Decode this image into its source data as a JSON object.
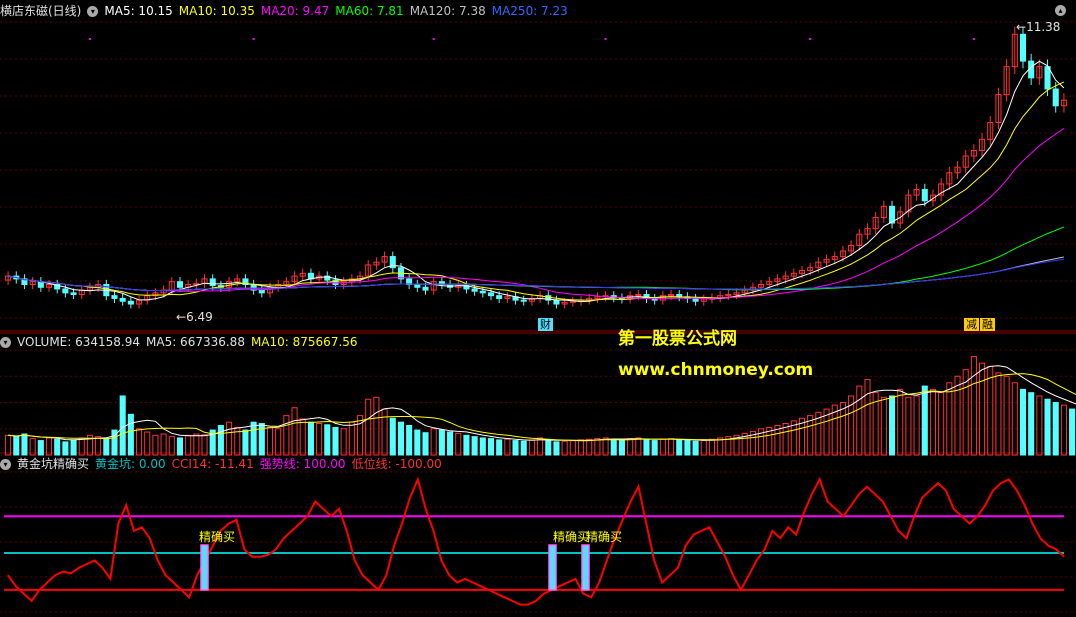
{
  "header_main": {
    "title": "横店东磁(日线)",
    "ma5": "MA5: 10.15",
    "ma10": "MA10: 10.35",
    "ma20": "MA20: 9.47",
    "ma60": "MA60: 7.81",
    "ma120": "MA120: 7.38",
    "ma250": "MA250: 7.23"
  },
  "header_volume": {
    "volume": "VOLUME: 634158.94",
    "ma5": "MA5: 667336.88",
    "ma10": "MA10: 875667.56"
  },
  "header_indicator": {
    "title": "黄金坑精确买",
    "golden_pit": "黄金坑: 0.00",
    "cci": "CCI14: -11.41",
    "strong_line": "强势线: 100.00",
    "low_line": "低位线: -100.00"
  },
  "annotations": {
    "high_label": "11.38",
    "low_label": "6.49",
    "cai_badge": "财",
    "jian_badge": "减",
    "rong_badge": "融",
    "buy_signal_1": "精确买",
    "buy_signal_2": "精确买",
    "buy_signal_3": "精确买"
  },
  "watermark": {
    "line1": "第一股票公式网",
    "line2": "www.chnmoney.com"
  },
  "colors": {
    "up": "#ff3232",
    "down": "#54ffff",
    "ma5": "#ffffff",
    "ma10": "#ffff00",
    "ma20": "#ff00ff",
    "ma60": "#00ff00",
    "ma120": "#c0c0c0",
    "ma250": "#3333ff",
    "cci": "#ff0000",
    "strong": "#ff00ff",
    "zero": "#00c0c0",
    "low": "#ff0000"
  },
  "chart_data": [
    {
      "type": "candlestick",
      "title": "横店东磁(日线)",
      "price_range": [
        6.3,
        11.6
      ],
      "high_marker": 11.38,
      "low_marker": 6.49,
      "close_series": [
        7.05,
        7.0,
        6.9,
        6.95,
        6.85,
        6.9,
        6.82,
        6.75,
        6.72,
        6.8,
        6.85,
        6.9,
        6.7,
        6.65,
        6.6,
        6.55,
        6.62,
        6.7,
        6.75,
        6.8,
        6.95,
        6.85,
        6.9,
        6.92,
        7.0,
        6.88,
        6.85,
        6.95,
        7.0,
        6.9,
        6.8,
        6.75,
        6.85,
        6.9,
        6.95,
        7.05,
        7.1,
        7.0,
        7.05,
        6.98,
        6.9,
        6.95,
        7.0,
        7.05,
        7.25,
        7.3,
        7.4,
        7.2,
        7.0,
        6.9,
        6.85,
        6.8,
        6.95,
        6.9,
        6.85,
        6.88,
        6.82,
        6.78,
        6.75,
        6.7,
        6.65,
        6.68,
        6.62,
        6.6,
        6.65,
        6.7,
        6.62,
        6.55,
        6.58,
        6.6,
        6.62,
        6.65,
        6.68,
        6.7,
        6.66,
        6.64,
        6.7,
        6.72,
        6.65,
        6.62,
        6.7,
        6.72,
        6.68,
        6.65,
        6.6,
        6.64,
        6.66,
        6.7,
        6.72,
        6.75,
        6.8,
        6.85,
        6.9,
        6.95,
        7.0,
        7.05,
        7.1,
        7.15,
        7.2,
        7.3,
        7.35,
        7.4,
        7.5,
        7.6,
        7.8,
        7.9,
        8.1,
        8.3,
        8.0,
        8.2,
        8.5,
        8.6,
        8.4,
        8.5,
        8.7,
        8.9,
        9.0,
        9.2,
        9.3,
        9.5,
        9.8,
        10.3,
        10.8,
        11.38,
        10.9,
        10.6,
        10.8,
        10.4,
        10.1,
        10.2
      ],
      "ma_series": [
        {
          "name": "MA5",
          "last": 10.15
        },
        {
          "name": "MA10",
          "last": 10.35
        },
        {
          "name": "MA20",
          "last": 9.47
        },
        {
          "name": "MA60",
          "last": 7.81
        },
        {
          "name": "MA120",
          "last": 7.38
        },
        {
          "name": "MA250",
          "last": 7.23
        }
      ]
    },
    {
      "type": "bar",
      "title": "VOLUME",
      "volume_max": 1600000,
      "volume_series": [
        300000,
        280000,
        320000,
        250000,
        220000,
        260000,
        240000,
        200000,
        230000,
        260000,
        300000,
        280000,
        250000,
        380000,
        900000,
        620000,
        400000,
        350000,
        300000,
        320000,
        280000,
        260000,
        300000,
        320000,
        310000,
        380000,
        450000,
        500000,
        420000,
        380000,
        500000,
        480000,
        420000,
        400000,
        600000,
        720000,
        550000,
        500000,
        480000,
        460000,
        420000,
        400000,
        500000,
        600000,
        850000,
        880000,
        700000,
        560000,
        500000,
        450000,
        380000,
        340000,
        400000,
        380000,
        350000,
        330000,
        300000,
        280000,
        260000,
        250000,
        230000,
        240000,
        220000,
        210000,
        230000,
        260000,
        220000,
        200000,
        210000,
        220000,
        230000,
        240000,
        250000,
        260000,
        240000,
        230000,
        250000,
        260000,
        240000,
        220000,
        240000,
        250000,
        230000,
        220000,
        210000,
        220000,
        240000,
        260000,
        280000,
        300000,
        330000,
        360000,
        400000,
        420000,
        450000,
        480000,
        520000,
        560000,
        600000,
        650000,
        700000,
        760000,
        800000,
        900000,
        1050000,
        1150000,
        950000,
        880000,
        900000,
        1000000,
        880000,
        900000,
        1050000,
        1000000,
        950000,
        1100000,
        1200000,
        1300000,
        1500000,
        1400000,
        1350000,
        1250000,
        1200000,
        1100000,
        1000000,
        950000,
        900000,
        850000,
        800000,
        760000,
        700000,
        650000
      ],
      "ma_series": [
        {
          "name": "MA5",
          "last": 667336.88
        },
        {
          "name": "MA10",
          "last": 875667.56
        }
      ]
    },
    {
      "type": "line",
      "title": "黄金坑精确买",
      "value_range": [
        -160,
        220
      ],
      "levels": {
        "strong": 100,
        "zero": 0,
        "low": -100
      },
      "cci_series": [
        -60,
        -90,
        -110,
        -130,
        -100,
        -80,
        -60,
        -50,
        -55,
        -40,
        -30,
        -20,
        -40,
        -70,
        80,
        130,
        60,
        70,
        40,
        -20,
        -60,
        -80,
        -100,
        -120,
        -60,
        -20,
        20,
        60,
        80,
        90,
        10,
        -10,
        -10,
        -5,
        10,
        40,
        60,
        80,
        100,
        140,
        120,
        100,
        120,
        60,
        -20,
        -60,
        -80,
        -100,
        -60,
        20,
        80,
        150,
        200,
        120,
        60,
        -20,
        -60,
        -80,
        -70,
        -80,
        -90,
        -100,
        -110,
        -120,
        -130,
        -140,
        -140,
        -130,
        -110,
        -100,
        -90,
        -80,
        -70,
        -110,
        -120,
        -80,
        -20,
        40,
        90,
        140,
        180,
        80,
        -20,
        -80,
        -60,
        -40,
        20,
        50,
        60,
        70,
        30,
        -10,
        -60,
        -100,
        -60,
        -20,
        10,
        60,
        40,
        70,
        50,
        110,
        160,
        200,
        140,
        120,
        100,
        130,
        160,
        180,
        160,
        140,
        100,
        60,
        40,
        100,
        150,
        170,
        190,
        170,
        120,
        100,
        80,
        100,
        130,
        170,
        190,
        200,
        170,
        130,
        80,
        40,
        20,
        10,
        -10
      ]
    }
  ]
}
